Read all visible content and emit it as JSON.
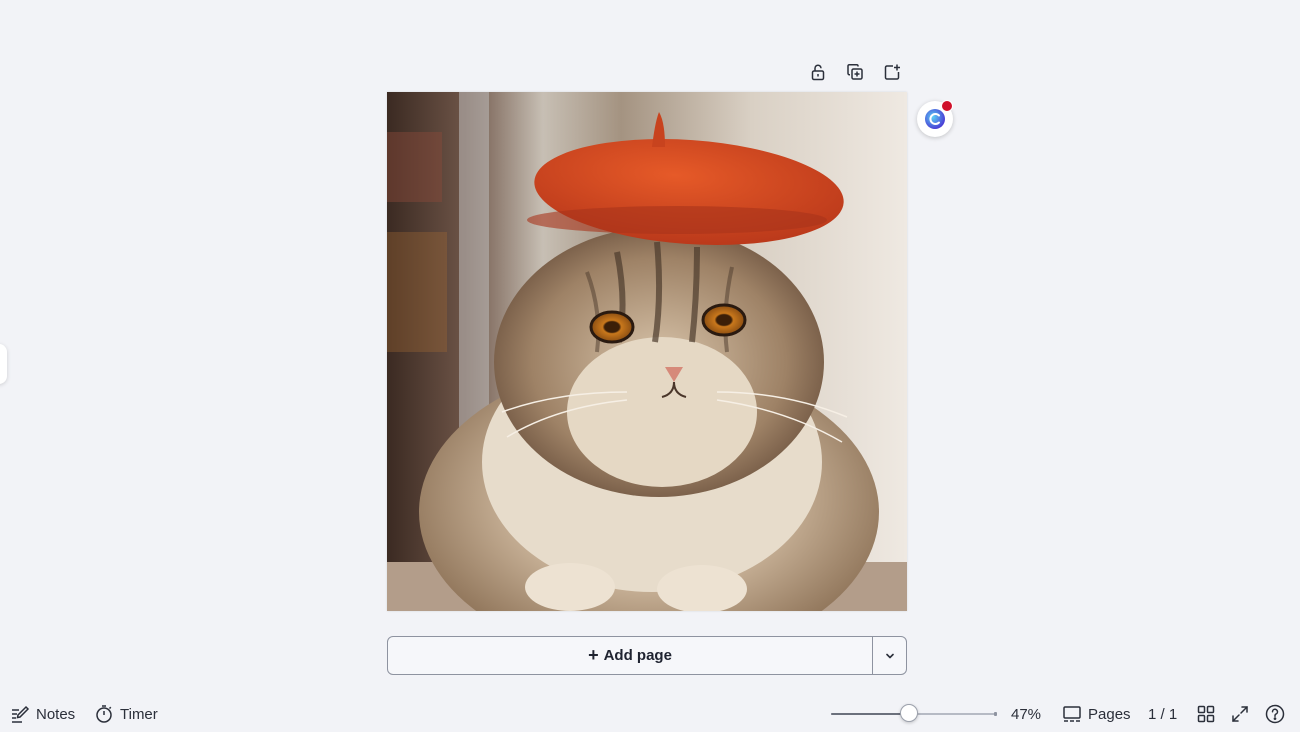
{
  "page_toolbar": {
    "lock_icon": "unlock-icon",
    "duplicate_icon": "duplicate-page-icon",
    "add_icon": "add-page-icon"
  },
  "canvas": {
    "image_subject": "photo-cat-beret"
  },
  "assistant": {
    "icon": "assistant-icon",
    "notification_color": "#d0102b"
  },
  "add_page": {
    "plus": "+",
    "label": "Add page",
    "more_icon": "chevron-down-icon"
  },
  "bottom_bar": {
    "notes_label": "Notes",
    "timer_label": "Timer",
    "zoom_value": "47%",
    "zoom_level": 0.47,
    "pages_label": "Pages",
    "page_count": "1 / 1"
  },
  "colors": {
    "background": "#f2f3f7",
    "beret": "#d4471f",
    "text": "#1f2330"
  }
}
